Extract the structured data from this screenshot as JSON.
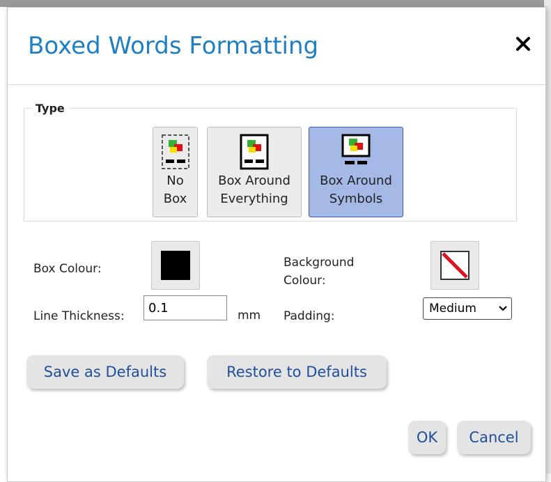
{
  "dialog": {
    "title": "Boxed Words Formatting",
    "close_symbol": "✕"
  },
  "type_group": {
    "legend": "Type",
    "options": [
      {
        "label_line1": "No",
        "label_line2": "Box",
        "icon": "no-box-icon",
        "selected": false
      },
      {
        "label_line1": "Box Around",
        "label_line2": "Everything",
        "icon": "box-around-everything-icon",
        "selected": false
      },
      {
        "label_line1": "Box Around",
        "label_line2": "Symbols",
        "icon": "box-around-symbols-icon",
        "selected": true
      }
    ]
  },
  "box_colour": {
    "label": "Box Colour:",
    "value_color": "#000000"
  },
  "background_colour": {
    "label_line1": "Background",
    "label_line2": "Colour:",
    "value": "none"
  },
  "line_thickness": {
    "label": "Line Thickness:",
    "value": "0.1",
    "unit": "mm"
  },
  "padding": {
    "label": "Padding:",
    "selected": "Medium"
  },
  "buttons": {
    "save_defaults": "Save as Defaults",
    "restore_defaults": "Restore to Defaults",
    "ok": "OK",
    "cancel": "Cancel"
  },
  "colors": {
    "title": "#1f7fc4",
    "button_text": "#1f4f9a",
    "selected_bg": "#a4b9e6"
  }
}
